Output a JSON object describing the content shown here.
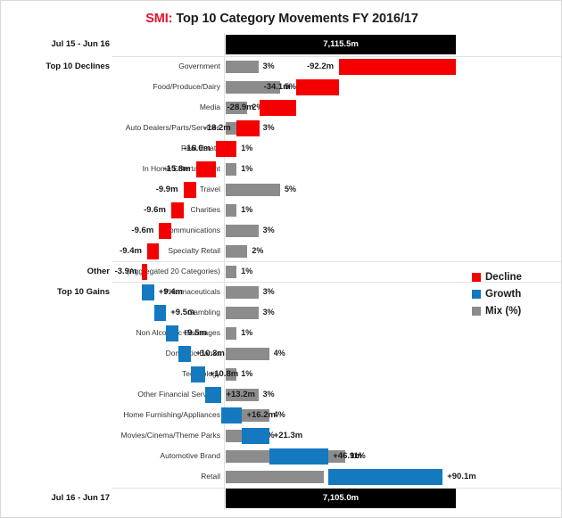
{
  "title": {
    "brand": "SMI:",
    "text": " Top 10 Category Movements FY 2016/17"
  },
  "legend": {
    "items": [
      {
        "label": "Decline",
        "color": "#f40000"
      },
      {
        "label": "Growth",
        "color": "#1479bf"
      },
      {
        "label": "Mix (%)",
        "color": "#8c8c8c"
      }
    ]
  },
  "groups": {
    "declines": "Top 10 Declines",
    "other": "Other",
    "gains": "Top 10 Gains"
  },
  "totals": {
    "start": {
      "group": "Jul 15 - Jun 16",
      "value": 7115.5,
      "label": "7,115.5m"
    },
    "end": {
      "group": "Jul 16 - Jun 17",
      "value": 7105.0,
      "label": "7,105.0m"
    }
  },
  "chart_data": {
    "type": "bar",
    "title": "SMI: Top 10 Category Movements FY 2016/17",
    "subtitle": "",
    "xlabel": "",
    "ylabel": "",
    "chart_style": "waterfall with secondary mix-percent bars",
    "legend_position": "right-middle",
    "grid": false,
    "start_total": {
      "label": "Jul 15 - Jun 16",
      "value": 7115.5,
      "value_label": "7,115.5m"
    },
    "end_total": {
      "label": "Jul 16 - Jun 17",
      "value": 7105.0,
      "value_label": "7,105.0m"
    },
    "categories": [
      "Government",
      "Food/Produce/Dairy",
      "Media",
      "Auto Dealers/Parts/Services",
      "Real Estate",
      "In Home Entertainment",
      "Travel",
      "Charities",
      "Communications",
      "Specialty Retail",
      "(Aggregated 20 Categories)",
      "Pharmaceuticals",
      "Gambling",
      "Non Alcoholic Beverages",
      "Domestic Banks",
      "Technology",
      "Other Financial Services",
      "Home Furnishing/Appliances",
      "Movies/Cinema/Theme Parks",
      "Automotive Brand",
      "Retail"
    ],
    "series": [
      {
        "name": "Movement (m)",
        "values": [
          -92.2,
          -34.1,
          -28.9,
          -18.2,
          -16.0,
          -15.8,
          -9.9,
          -9.6,
          -9.6,
          -9.4,
          -3.9,
          9.4,
          9.5,
          9.5,
          10.3,
          10.8,
          13.2,
          16.2,
          21.3,
          46.9,
          90.1
        ]
      },
      {
        "name": "Mix (%)",
        "values": [
          3,
          5,
          2,
          3,
          1,
          1,
          5,
          1,
          3,
          2,
          1,
          3,
          3,
          1,
          4,
          1,
          3,
          4,
          3,
          11,
          9
        ]
      }
    ]
  },
  "rows": [
    {
      "group": "Top 10 Declines",
      "category": "Government",
      "mix": 3,
      "mix_label": "3%",
      "value": -92.2,
      "value_label": "-92.2m",
      "kind": "decline"
    },
    {
      "group": "",
      "category": "Food/Produce/Dairy",
      "mix": 5,
      "mix_label": "5%",
      "value": -34.1,
      "value_label": "-34.1m",
      "kind": "decline"
    },
    {
      "group": "",
      "category": "Media",
      "mix": 2,
      "mix_label": "2%",
      "value": -28.9,
      "value_label": "-28.9m",
      "kind": "decline"
    },
    {
      "group": "",
      "category": "Auto Dealers/Parts/Services",
      "mix": 3,
      "mix_label": "3%",
      "value": -18.2,
      "value_label": "-18.2m",
      "kind": "decline"
    },
    {
      "group": "",
      "category": "Real Estate",
      "mix": 1,
      "mix_label": "1%",
      "value": -16.0,
      "value_label": "-16.0m",
      "kind": "decline"
    },
    {
      "group": "",
      "category": "In Home Entertainment",
      "mix": 1,
      "mix_label": "1%",
      "value": -15.8,
      "value_label": "-15.8m",
      "kind": "decline"
    },
    {
      "group": "",
      "category": "Travel",
      "mix": 5,
      "mix_label": "5%",
      "value": -9.9,
      "value_label": "-9.9m",
      "kind": "decline"
    },
    {
      "group": "",
      "category": "Charities",
      "mix": 1,
      "mix_label": "1%",
      "value": -9.6,
      "value_label": "-9.6m",
      "kind": "decline"
    },
    {
      "group": "",
      "category": "Communications",
      "mix": 3,
      "mix_label": "3%",
      "value": -9.6,
      "value_label": "-9.6m",
      "kind": "decline"
    },
    {
      "group": "",
      "category": "Specialty Retail",
      "mix": 2,
      "mix_label": "2%",
      "value": -9.4,
      "value_label": "-9.4m",
      "kind": "decline"
    },
    {
      "group": "Other",
      "category": "(Aggregated 20 Categories)",
      "mix": 1,
      "mix_label": "1%",
      "value": -3.9,
      "value_label": "-3.9m",
      "kind": "decline"
    },
    {
      "group": "Top 10 Gains",
      "category": "Pharmaceuticals",
      "mix": 3,
      "mix_label": "3%",
      "value": 9.4,
      "value_label": "+9.4m",
      "kind": "growth"
    },
    {
      "group": "",
      "category": "Gambling",
      "mix": 3,
      "mix_label": "3%",
      "value": 9.5,
      "value_label": "+9.5m",
      "kind": "growth"
    },
    {
      "group": "",
      "category": "Non Alcoholic Beverages",
      "mix": 1,
      "mix_label": "1%",
      "value": 9.5,
      "value_label": "+9.5m",
      "kind": "growth"
    },
    {
      "group": "",
      "category": "Domestic Banks",
      "mix": 4,
      "mix_label": "4%",
      "value": 10.3,
      "value_label": "+10.3m",
      "kind": "growth"
    },
    {
      "group": "",
      "category": "Technology",
      "mix": 1,
      "mix_label": "1%",
      "value": 10.8,
      "value_label": "+10.8m",
      "kind": "growth"
    },
    {
      "group": "",
      "category": "Other Financial Services",
      "mix": 3,
      "mix_label": "3%",
      "value": 13.2,
      "value_label": "+13.2m",
      "kind": "growth"
    },
    {
      "group": "",
      "category": "Home Furnishing/Appliances",
      "mix": 4,
      "mix_label": "4%",
      "value": 16.2,
      "value_label": "+16.2m",
      "kind": "growth"
    },
    {
      "group": "",
      "category": "Movies/Cinema/Theme Parks",
      "mix": 3,
      "mix_label": "3%",
      "value": 21.3,
      "value_label": "+21.3m",
      "kind": "growth"
    },
    {
      "group": "",
      "category": "Automotive Brand",
      "mix": 11,
      "mix_label": "11%",
      "value": 46.9,
      "value_label": "+46.9m",
      "kind": "growth"
    },
    {
      "group": "",
      "category": "Retail",
      "mix": 9,
      "mix_label": "9%",
      "value": 90.1,
      "value_label": "+90.1m",
      "kind": "growth"
    }
  ]
}
